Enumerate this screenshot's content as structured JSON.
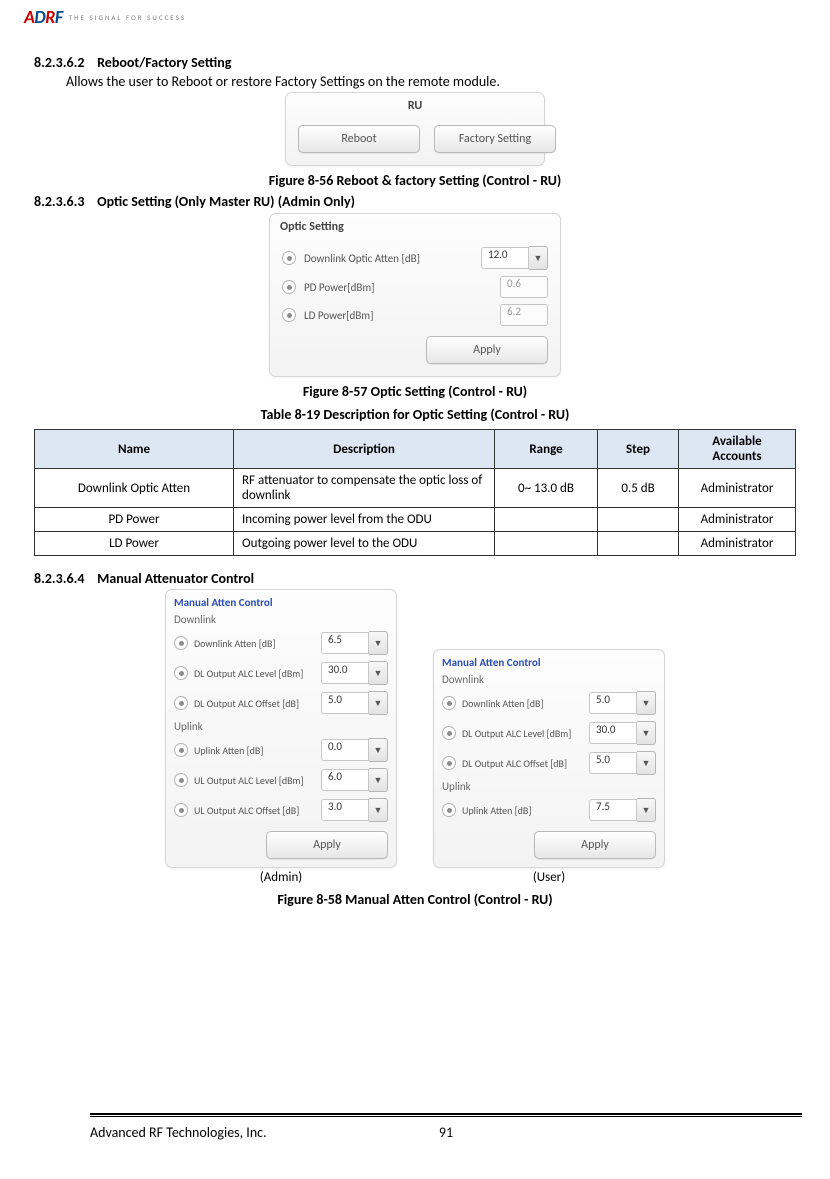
{
  "logo": {
    "text": "ADRF",
    "tagline": "THE SIGNAL FOR SUCCESS"
  },
  "sections": {
    "reboot": {
      "num": "8.2.3.6.2",
      "title": "Reboot/Factory Setting",
      "body": "Allows the user to Reboot or restore Factory Settings on the remote module."
    },
    "optic": {
      "num": "8.2.3.6.3",
      "title": "Optic Setting (Only Master RU) (Admin Only)"
    },
    "manual": {
      "num": "8.2.3.6.4",
      "title": "Manual Attenuator Control"
    }
  },
  "captions": {
    "fig56": "Figure 8-56    Reboot & factory Setting (Control - RU)",
    "fig57": "Figure 8-57    Optic Setting (Control - RU)",
    "tbl19": "Table 8-19     Description for Optic Setting (Control - RU)",
    "fig58": "Figure 8-58    Manual Atten Control (Control - RU)",
    "admin": "(Admin)",
    "user": "(User)"
  },
  "ru_panel": {
    "title": "RU",
    "reboot": "Reboot",
    "factory": "Factory Setting"
  },
  "optic_panel": {
    "title": "Optic Setting",
    "rows": [
      {
        "label": "Downlink Optic Atten [dB]",
        "value": "12.0",
        "editable": true
      },
      {
        "label": "PD Power[dBm]",
        "value": "0.6",
        "editable": false
      },
      {
        "label": "LD Power[dBm]",
        "value": "6.2",
        "editable": false
      }
    ],
    "apply": "Apply"
  },
  "optic_table": {
    "headers": [
      "Name",
      "Description",
      "Range",
      "Step",
      "Available Accounts"
    ],
    "rows": [
      {
        "name": "Downlink Optic Atten",
        "desc": "RF attenuator to compensate the optic loss of downlink",
        "range": "0~ 13.0 dB",
        "step": "0.5 dB",
        "acct": "Administrator"
      },
      {
        "name": "PD Power",
        "desc": "Incoming power level from the ODU",
        "range": "",
        "step": "",
        "acct": "Administrator"
      },
      {
        "name": "LD Power",
        "desc": "Outgoing power level to the ODU",
        "range": "",
        "step": "",
        "acct": "Administrator"
      }
    ]
  },
  "ma_admin": {
    "title": "Manual Atten Control",
    "dl_header": "Downlink",
    "ul_header": "Uplink",
    "dl": [
      {
        "label": "Downlink Atten [dB]",
        "value": "6.5"
      },
      {
        "label": "DL Output ALC Level [dBm]",
        "value": "30.0"
      },
      {
        "label": "DL Output ALC Offset [dB]",
        "value": "5.0"
      }
    ],
    "ul": [
      {
        "label": "Uplink Atten [dB]",
        "value": "0.0"
      },
      {
        "label": "UL Output ALC Level [dBm]",
        "value": "6.0"
      },
      {
        "label": "UL Output ALC Offset [dB]",
        "value": "3.0"
      }
    ],
    "apply": "Apply"
  },
  "ma_user": {
    "title": "Manual Atten Control",
    "dl_header": "Downlink",
    "ul_header": "Uplink",
    "dl": [
      {
        "label": "Downlink Atten [dB]",
        "value": "5.0"
      },
      {
        "label": "DL Output ALC Level [dBm]",
        "value": "30.0"
      },
      {
        "label": "DL Output ALC Offset [dB]",
        "value": "5.0"
      }
    ],
    "ul": [
      {
        "label": "Uplink Atten [dB]",
        "value": "7.5"
      }
    ],
    "apply": "Apply"
  },
  "footer": {
    "company": "Advanced RF Technologies, Inc.",
    "page": "91"
  }
}
